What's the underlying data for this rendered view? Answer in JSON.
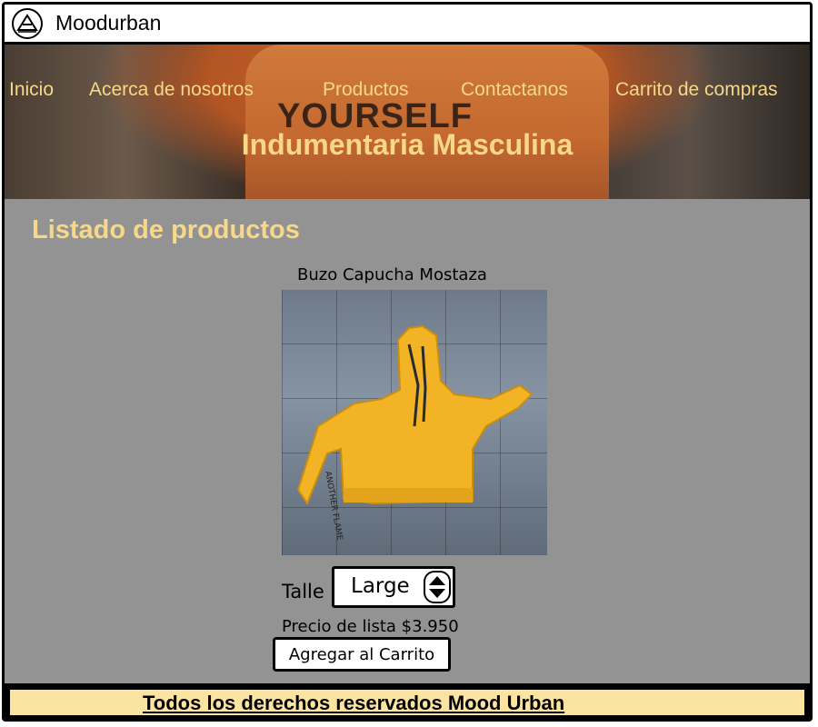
{
  "app": {
    "title": "Moodurban",
    "logo_icon": "pyramid-logo-icon"
  },
  "nav": {
    "items": [
      {
        "label": "Inicio"
      },
      {
        "label": "Acerca de nosotros"
      },
      {
        "label": "Productos"
      },
      {
        "label": "Contactanos"
      },
      {
        "label": "Carrito de compras"
      }
    ]
  },
  "hero": {
    "title": "Indumentaria Masculina",
    "shirt_text": "YOURSELF"
  },
  "main": {
    "section_title": "Listado de productos",
    "product": {
      "name": "Buzo Capucha Mostaza",
      "size_label": "Talle",
      "size_selected": "Large",
      "price_text": "Precio de lista $3.950",
      "add_button_label": "Agregar al Carrito",
      "sleeve_text": "ANOTHER FLAME"
    }
  },
  "footer": {
    "text": "Todos los derechos reservados Mood Urban"
  },
  "colors": {
    "accent": "#f7d889",
    "content_bg": "#939393",
    "footer_bg": "#fbe3a2",
    "hoodie": "#f2b324"
  }
}
